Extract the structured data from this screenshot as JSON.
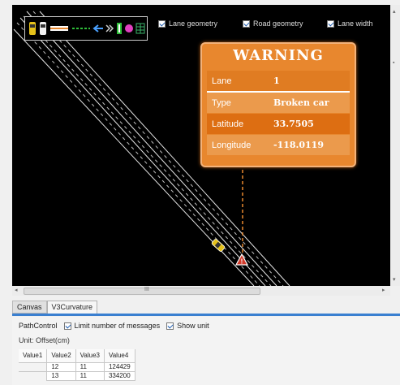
{
  "checkboxes": {
    "lane_geometry": {
      "label": "Lane geometry",
      "checked": true
    },
    "road_geometry": {
      "label": "Road geometry",
      "checked": true
    },
    "lane_width": {
      "label": "Lane width",
      "checked": true
    }
  },
  "legend_icons": [
    "yellow-car-icon",
    "white-car-icon",
    "orange-line-icon",
    "green-dashed-line-icon",
    "blue-arrow-icon",
    "double-arrow-icon",
    "green-traffic-light-icon",
    "magenta-circle-icon",
    "grid-icon"
  ],
  "warning": {
    "title": "WARNING",
    "rows": [
      {
        "key": "Lane",
        "value": "1"
      },
      {
        "key": "Type",
        "value": "Broken car"
      },
      {
        "key": "Latitude",
        "value": "33.7505"
      },
      {
        "key": "Longitude",
        "value": "-118.0119"
      }
    ]
  },
  "scrollbar": {
    "grip": "III"
  },
  "tabs": [
    {
      "label": "Canvas",
      "active": false
    },
    {
      "label": "V3Curvature",
      "active": true
    }
  ],
  "path_control": {
    "label": "PathControl",
    "limit_messages": {
      "label": "Limit number of messages",
      "checked": true
    },
    "show_unit": {
      "label": "Show unit",
      "checked": true
    },
    "unit": "Unit: Offset(cm)"
  },
  "grid": {
    "columns": [
      "Value1",
      "Value2",
      "Value3",
      "Value4"
    ],
    "rows": [
      [
        "",
        "12",
        "11",
        "124429"
      ],
      [
        "",
        "13",
        "11",
        "334200"
      ]
    ]
  },
  "colors": {
    "canvas_bg": "#000000",
    "warning_orange": "#e8872e",
    "accent_blue": "#3a7fd0",
    "hazard_red": "#d23a2a"
  }
}
